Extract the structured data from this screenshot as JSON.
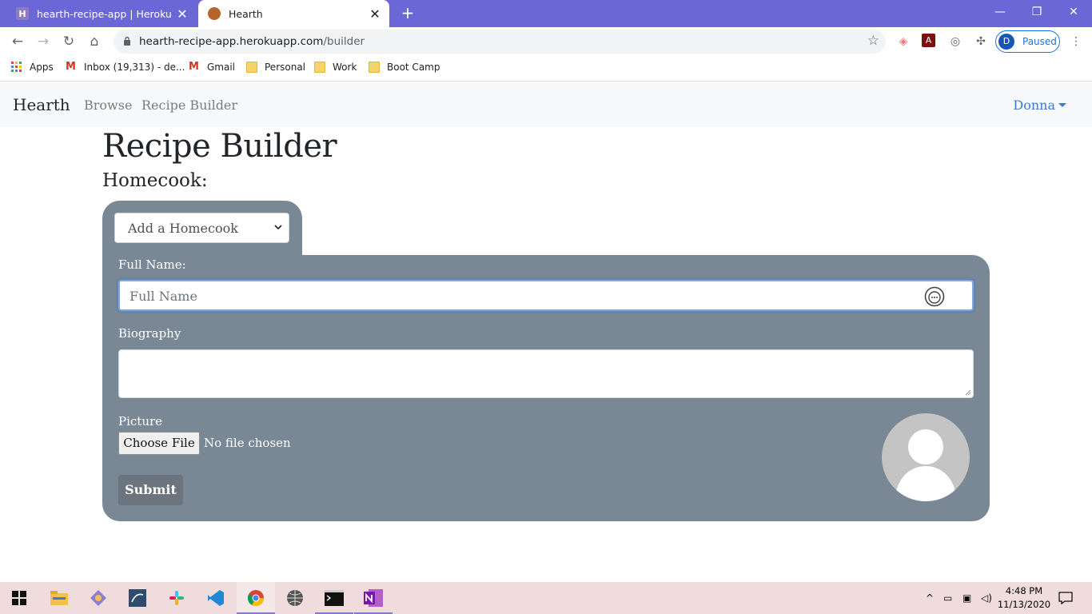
{
  "browser": {
    "tabs": [
      {
        "title": "hearth-recipe-app | Heroku",
        "active": false
      },
      {
        "title": "Hearth",
        "active": true
      }
    ],
    "url_host": "hearth-recipe-app.herokuapp.com",
    "url_path": "/builder",
    "profile_initial": "D",
    "profile_status": "Paused",
    "bookmarks": [
      "Apps",
      "Inbox (19,313) - de...",
      "Gmail",
      "Personal",
      "Work",
      "Boot Camp"
    ]
  },
  "navbar": {
    "brand": "Hearth",
    "links": [
      "Browse",
      "Recipe Builder"
    ],
    "user": "Donna"
  },
  "page": {
    "title": "Recipe Builder",
    "section": "Homecook:",
    "select_value": "Add a Homecook",
    "full_name_label": "Full Name:",
    "full_name_placeholder": "Full Name",
    "biography_label": "Biography",
    "picture_label": "Picture",
    "choose_file": "Choose File",
    "no_file": "No file chosen",
    "submit": "Submit"
  },
  "taskbar": {
    "time": "4:48 PM",
    "date": "11/13/2020"
  },
  "colors": {
    "panel": "#7a8896",
    "tabbar": "#6b67d6",
    "accent": "#3a7ad5"
  }
}
